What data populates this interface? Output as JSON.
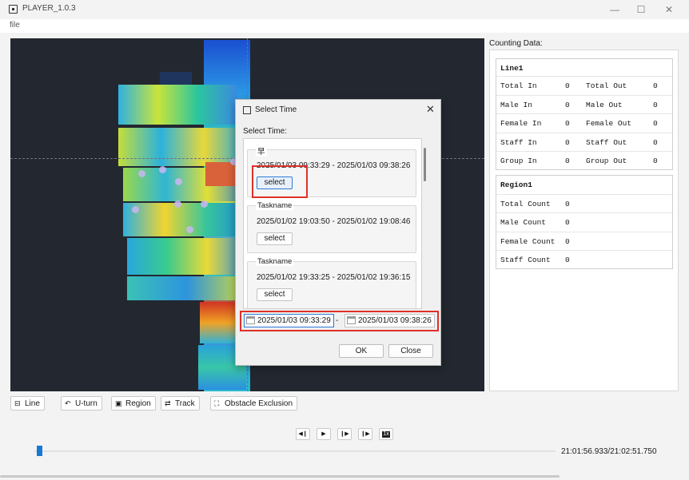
{
  "window": {
    "title": "PLAYER_1.0.3",
    "minimize": "—",
    "maximize": "☐",
    "close": "✕"
  },
  "menu": {
    "file": "file"
  },
  "counting": {
    "title": "Counting Data:",
    "line": {
      "name": "Line1",
      "rows": [
        {
          "in_label": "Total In",
          "in_value": "0",
          "out_label": "Total Out",
          "out_value": "0"
        },
        {
          "in_label": "Male In",
          "in_value": "0",
          "out_label": "Male Out",
          "out_value": "0"
        },
        {
          "in_label": "Female In",
          "in_value": "0",
          "out_label": "Female Out",
          "out_value": "0"
        },
        {
          "in_label": "Staff In",
          "in_value": "0",
          "out_label": "Staff Out",
          "out_value": "0"
        },
        {
          "in_label": "Group In",
          "in_value": "0",
          "out_label": "Group Out",
          "out_value": "0"
        }
      ]
    },
    "region": {
      "name": "Region1",
      "rows": [
        {
          "label": "Total Count",
          "value": "0"
        },
        {
          "label": "Male Count",
          "value": "0"
        },
        {
          "label": "Female Count",
          "value": "0"
        },
        {
          "label": "Staff Count",
          "value": "0"
        }
      ]
    }
  },
  "toolbar": {
    "line": "Line",
    "uturn": "U-turn",
    "region": "Region",
    "track": "Track",
    "obstacle": "Obstacle Exclusion"
  },
  "playback": {
    "buttons": [
      "prev-frame",
      "play",
      "next",
      "next-frame",
      "speed-1x"
    ],
    "speed_label": "1x",
    "progress": 0.005,
    "timecode": "21:01:56.933/21:02:51.750"
  },
  "dialog": {
    "title": "Select Time",
    "close": "✕",
    "label": "Select Time:",
    "tasks": [
      {
        "name": "早",
        "range": "2025/01/03 09:33:29 - 2025/01/03 09:38:26",
        "select": "select"
      },
      {
        "name": "Taskname",
        "range": "2025/01/02 19:03:50 - 2025/01/02 19:08:46",
        "select": "select"
      },
      {
        "name": "Taskname",
        "range": "2025/01/02 19:33:25 - 2025/01/02 19:36:15",
        "select": "select"
      }
    ],
    "start": "2025/01/03 09:33:29",
    "dash": "-",
    "end": "2025/01/03 09:38:26",
    "ok": "OK",
    "cancel": "Close"
  },
  "colors": {
    "accent": "#1679d2",
    "highlight": "#e0302a",
    "video_bg": "#232830"
  }
}
